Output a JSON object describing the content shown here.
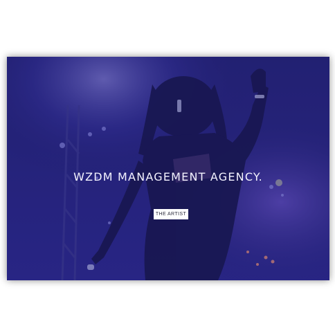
{
  "hero": {
    "headline": "WZDM MANAGEMENT AGENCY.",
    "cta_label": "THE ARTIST",
    "image": "performer-on-stage-photo",
    "overlay_color": "#23207d"
  },
  "colors": {
    "page_background": "#ffffff",
    "hero_tint": "#1d1c63",
    "headline_text": "#f4f3ff",
    "button_background": "#ffffff",
    "button_text": "#2a2a3a"
  }
}
